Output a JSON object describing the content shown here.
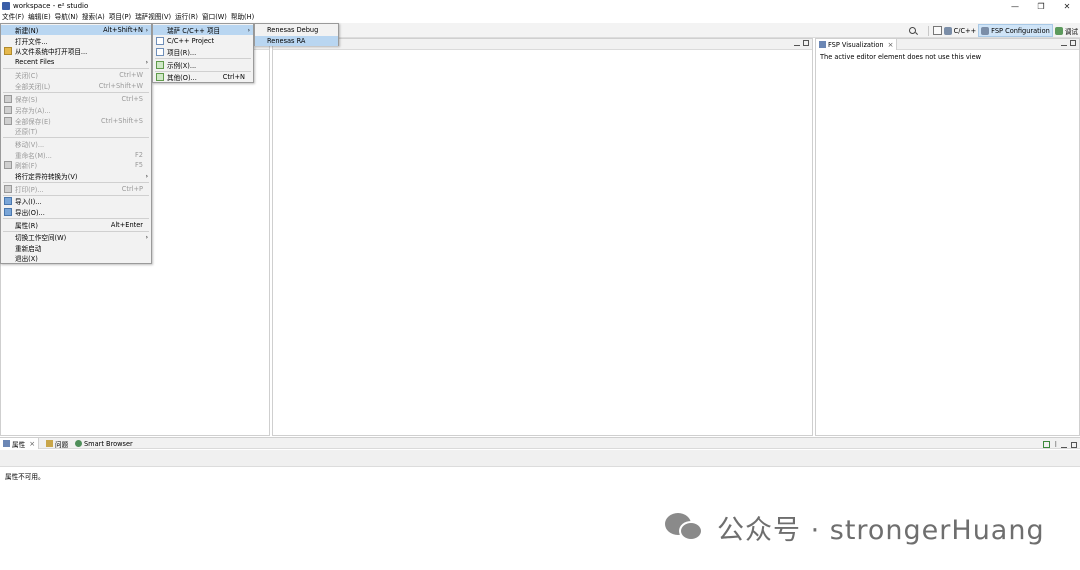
{
  "window": {
    "title": "workspace - e² studio",
    "controls": [
      "—",
      "❐",
      "✕"
    ]
  },
  "menubar": [
    "文件(F)",
    "编辑(E)",
    "导航(N)",
    "搜索(A)",
    "项目(P)",
    "瑞萨视图(V)",
    "运行(R)",
    "窗口(W)",
    "帮助(H)"
  ],
  "toolbar": {
    "perspectives": [
      {
        "label": "C/C++",
        "active": false
      },
      {
        "label": "FSP Configuration",
        "active": true
      },
      {
        "label": "调试",
        "active": false
      }
    ]
  },
  "file_menu": {
    "items": [
      {
        "label": "新建(N)",
        "shortcut": "Alt+Shift+N",
        "submenu": true,
        "highlight": true,
        "disabled": false,
        "icon": ""
      },
      {
        "label": "打开文件...",
        "shortcut": "",
        "submenu": false,
        "disabled": false,
        "icon": ""
      },
      {
        "label": "从文件系统中打开项目...",
        "shortcut": "",
        "submenu": false,
        "disabled": false,
        "icon": "folder-icon"
      },
      {
        "label": "Recent Files",
        "shortcut": "",
        "submenu": true,
        "disabled": false,
        "icon": ""
      },
      {
        "label": "关闭(C)",
        "shortcut": "Ctrl+W",
        "submenu": false,
        "disabled": true,
        "icon": ""
      },
      {
        "label": "全部关闭(L)",
        "shortcut": "Ctrl+Shift+W",
        "submenu": false,
        "disabled": true,
        "icon": ""
      },
      {
        "label": "保存(S)",
        "shortcut": "Ctrl+S",
        "submenu": false,
        "disabled": true,
        "icon": "save-icon"
      },
      {
        "label": "另存为(A)...",
        "shortcut": "",
        "submenu": false,
        "disabled": true,
        "icon": "save-as-icon"
      },
      {
        "label": "全部保存(E)",
        "shortcut": "Ctrl+Shift+S",
        "submenu": false,
        "disabled": true,
        "icon": "save-all-icon"
      },
      {
        "label": "还原(T)",
        "shortcut": "",
        "submenu": false,
        "disabled": true,
        "icon": ""
      },
      {
        "label": "移动(V)...",
        "shortcut": "",
        "submenu": false,
        "disabled": true,
        "icon": ""
      },
      {
        "label": "重命名(M)...",
        "shortcut": "F2",
        "submenu": false,
        "disabled": true,
        "icon": ""
      },
      {
        "label": "刷新(F)",
        "shortcut": "F5",
        "submenu": false,
        "disabled": true,
        "icon": "refresh-icon"
      },
      {
        "label": "将行定界符转换为(V)",
        "shortcut": "",
        "submenu": true,
        "disabled": false,
        "icon": ""
      },
      {
        "label": "打印(P)...",
        "shortcut": "Ctrl+P",
        "submenu": false,
        "disabled": true,
        "icon": "print-icon"
      },
      {
        "label": "导入(I)...",
        "shortcut": "",
        "submenu": false,
        "disabled": false,
        "icon": "import-icon"
      },
      {
        "label": "导出(O)...",
        "shortcut": "",
        "submenu": false,
        "disabled": false,
        "icon": "export-icon"
      },
      {
        "label": "属性(R)",
        "shortcut": "Alt+Enter",
        "submenu": false,
        "disabled": false,
        "icon": ""
      },
      {
        "label": "切换工作空间(W)",
        "shortcut": "",
        "submenu": true,
        "disabled": false,
        "icon": ""
      },
      {
        "label": "重新启动",
        "shortcut": "",
        "submenu": false,
        "disabled": false,
        "icon": ""
      },
      {
        "label": "退出(X)",
        "shortcut": "",
        "submenu": false,
        "disabled": false,
        "icon": ""
      }
    ]
  },
  "new_submenu": {
    "items": [
      {
        "label": "瑞萨 C/C++ 项目",
        "shortcut": "",
        "submenu": true,
        "highlight": true,
        "icon": ""
      },
      {
        "label": "C/C++ Project",
        "shortcut": "",
        "submenu": false,
        "icon": "cpp-project-icon"
      },
      {
        "label": "项目(R)...",
        "shortcut": "",
        "submenu": false,
        "icon": "project-icon"
      },
      {
        "label": "示例(X)...",
        "shortcut": "",
        "submenu": false,
        "icon": "example-icon"
      },
      {
        "label": "其他(O)...",
        "shortcut": "Ctrl+N",
        "submenu": false,
        "icon": "other-icon"
      }
    ]
  },
  "renesas_submenu": {
    "items": [
      {
        "label": "Renesas Debug",
        "highlight": false
      },
      {
        "label": "Renesas RA",
        "highlight": true
      }
    ]
  },
  "fsp_panel": {
    "tab_label": "FSP Visualization",
    "message": "The active editor element does not use this view"
  },
  "bottom_panel": {
    "tabs": [
      "属性",
      "问题",
      "Smart Browser"
    ],
    "message": "属性不可用。"
  },
  "watermark": {
    "text": "公众号 · strongerHuang"
  }
}
